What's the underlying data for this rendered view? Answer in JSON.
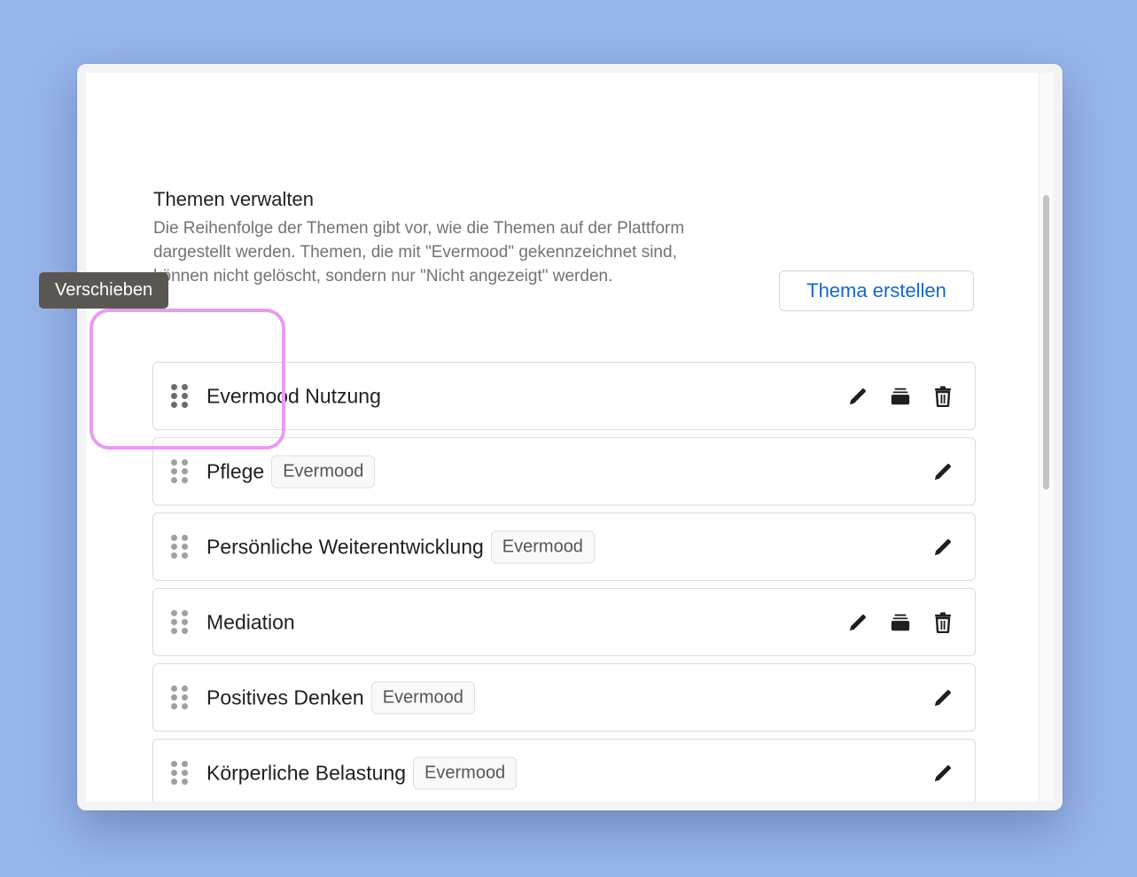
{
  "page": {
    "title": "Themen verwalten",
    "description": "Die Reihenfolge der Themen gibt vor, wie die Themen auf der Plattform dargestellt werden. Themen, die mit \"Evermood\" gekennzeichnet sind, können nicht gelöscht, sondern nur \"Nicht angezeigt\" werden.",
    "create_button": "Thema erstellen"
  },
  "tooltip": "Verschieben",
  "topics": [
    {
      "title": "Evermood Nutzung",
      "badge": "",
      "actions": [
        "pencil-icon",
        "archive-icon",
        "trash-icon"
      ]
    },
    {
      "title": "Pflege",
      "badge": "Evermood",
      "actions": [
        "pencil-icon"
      ]
    },
    {
      "title": "Persönliche Weiterentwicklung",
      "badge": "Evermood",
      "actions": [
        "pencil-icon"
      ]
    },
    {
      "title": "Mediation",
      "badge": "",
      "actions": [
        "pencil-icon",
        "archive-icon",
        "trash-icon"
      ]
    },
    {
      "title": "Positives Denken",
      "badge": "Evermood",
      "actions": [
        "pencil-icon"
      ]
    },
    {
      "title": "Körperliche Belastung",
      "badge": "Evermood",
      "actions": [
        "pencil-icon"
      ]
    }
  ],
  "colors": {
    "background": "#97b5eb",
    "accent": "#1866c8",
    "highlight": "#e89cf0",
    "tooltip": "#5a5752"
  }
}
